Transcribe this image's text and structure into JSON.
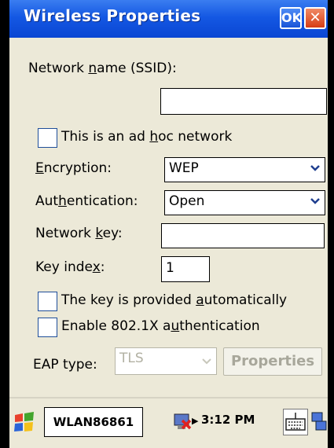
{
  "window": {
    "title": "Wireless Properties",
    "ok_label": "OK",
    "close_label": "✕"
  },
  "form": {
    "ssid_label_pre": "Network ",
    "ssid_label_u": "n",
    "ssid_label_post": "ame (SSID):",
    "ssid_value": "",
    "adhoc_label_pre": "This is an ad ",
    "adhoc_label_u": "h",
    "adhoc_label_post": "oc network",
    "adhoc_checked": false,
    "encryption_label_pre": "",
    "encryption_label_u": "E",
    "encryption_label_post": "ncryption:",
    "encryption_value": "WEP",
    "auth_label_pre": "Aut",
    "auth_label_u": "h",
    "auth_label_post": "entication:",
    "auth_value": "Open",
    "netkey_label_pre": "Network ",
    "netkey_label_u": "k",
    "netkey_label_post": "ey:",
    "netkey_value": "",
    "keyindex_label_pre": "Key inde",
    "keyindex_label_u": "x",
    "keyindex_label_post": ":",
    "keyindex_value": "1",
    "autokey_label_pre": "The key is provided ",
    "autokey_label_u": "a",
    "autokey_label_post": "utomatically",
    "autokey_checked": false,
    "dot1x_label_pre": "Enable 802.1X a",
    "dot1x_label_u": "u",
    "dot1x_label_post": "thentication",
    "dot1x_checked": false,
    "eap_label": "EAP type:",
    "eap_value": "TLS",
    "properties_label": "Properties"
  },
  "taskbar": {
    "task_label": "WLAN86861",
    "time": "3:12 PM"
  },
  "colors": {
    "titlebar": "#0a46d3",
    "background": "#ece9d8",
    "close": "#d63c14"
  }
}
